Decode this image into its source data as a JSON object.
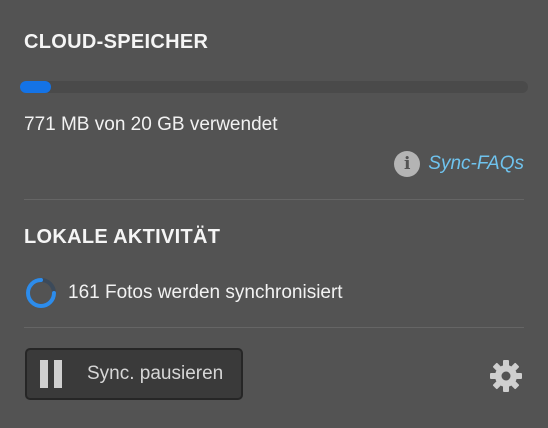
{
  "cloud_storage": {
    "title": "CLOUD-SPEICHER",
    "used_fraction": 0.035,
    "usage_text": "771 MB von 20 GB verwendet",
    "faq_link": "Sync-FAQs",
    "progress_color": "#1473e6"
  },
  "local_activity": {
    "title": "LOKALE AKTIVITÄT",
    "sync_status": "161 Fotos werden synchronisiert",
    "spinner_color": "#2d8ceb"
  },
  "footer": {
    "pause_label": "Sync. pausieren",
    "pause_icon": "pause-icon",
    "settings_icon": "gear-icon"
  },
  "colors": {
    "background": "#535353",
    "link": "#6fc3ee"
  }
}
